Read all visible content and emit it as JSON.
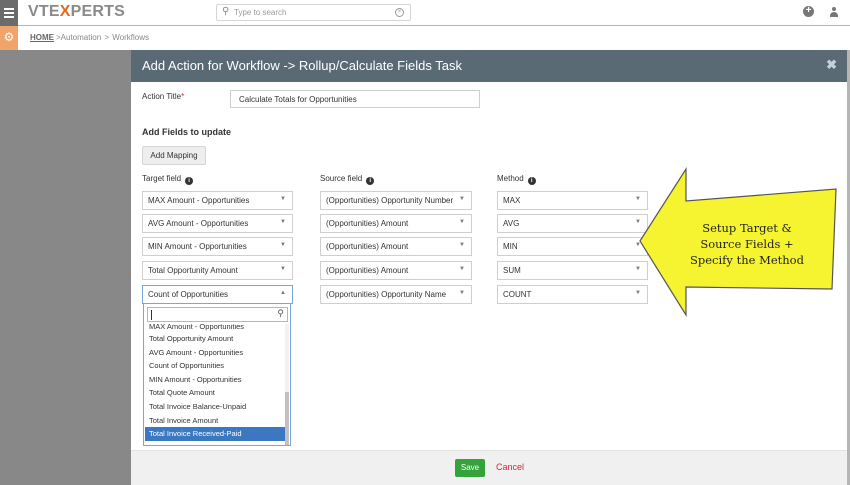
{
  "topbar": {
    "logo_prefix": "VTE",
    "logo_x": "X",
    "logo_suffix": "PERTS",
    "search_placeholder": "Type to search",
    "plus_icon": "plus-circle-icon",
    "user_icon": "user-icon"
  },
  "breadcrumb": {
    "home": "HOME",
    "items": [
      ">Automation",
      ">",
      "Workflows"
    ]
  },
  "modal": {
    "title": "Add Action for Workflow -> Rollup/Calculate Fields Task",
    "close": "✖",
    "action_title_label": "Action Title",
    "required_mark": "*",
    "action_title_value": "Calculate Totals for Opportunities",
    "fields_heading": "Add Fields to update",
    "add_mapping_label": "Add Mapping",
    "columns": {
      "target": "Target field",
      "source": "Source field",
      "method": "Method"
    },
    "rows": [
      {
        "target": "MAX Amount - Opportunities",
        "source": "(Opportunities) Opportunity Number",
        "method": "MAX"
      },
      {
        "target": "AVG Amount - Opportunities",
        "source": "(Opportunities) Amount",
        "method": "AVG"
      },
      {
        "target": "MIN Amount - Opportunities",
        "source": "(Opportunities) Amount",
        "method": "MIN"
      },
      {
        "target": "Total Opportunity Amount",
        "source": "(Opportunities) Amount",
        "method": "SUM"
      },
      {
        "target": "Count of Opportunities",
        "source": "(Opportunities) Opportunity Name",
        "method": "COUNT"
      }
    ],
    "dropdown_options": [
      "MAX Amount - Opportunities",
      "Total Opportunity Amount",
      "AVG Amount - Opportunities",
      "Count of Opportunities",
      "MIN Amount - Opportunities",
      "Total Quote Amount",
      "Total Invoice Balance-Unpaid",
      "Total Invoice Amount",
      "Total Invoice Received-Paid"
    ],
    "dropdown_highlighted": "Total Invoice Received-Paid",
    "save_label": "Save",
    "cancel_label": "Cancel"
  },
  "callout": {
    "lines": [
      "Setup Target &",
      "Source Fields +",
      "Specify the Method"
    ],
    "fill": "#f6f431"
  },
  "colors": {
    "header": "#596a75",
    "accent": "#e56a1c",
    "save": "#35a33b",
    "cancel": "#d9272d",
    "highlight": "#3b78c2"
  }
}
